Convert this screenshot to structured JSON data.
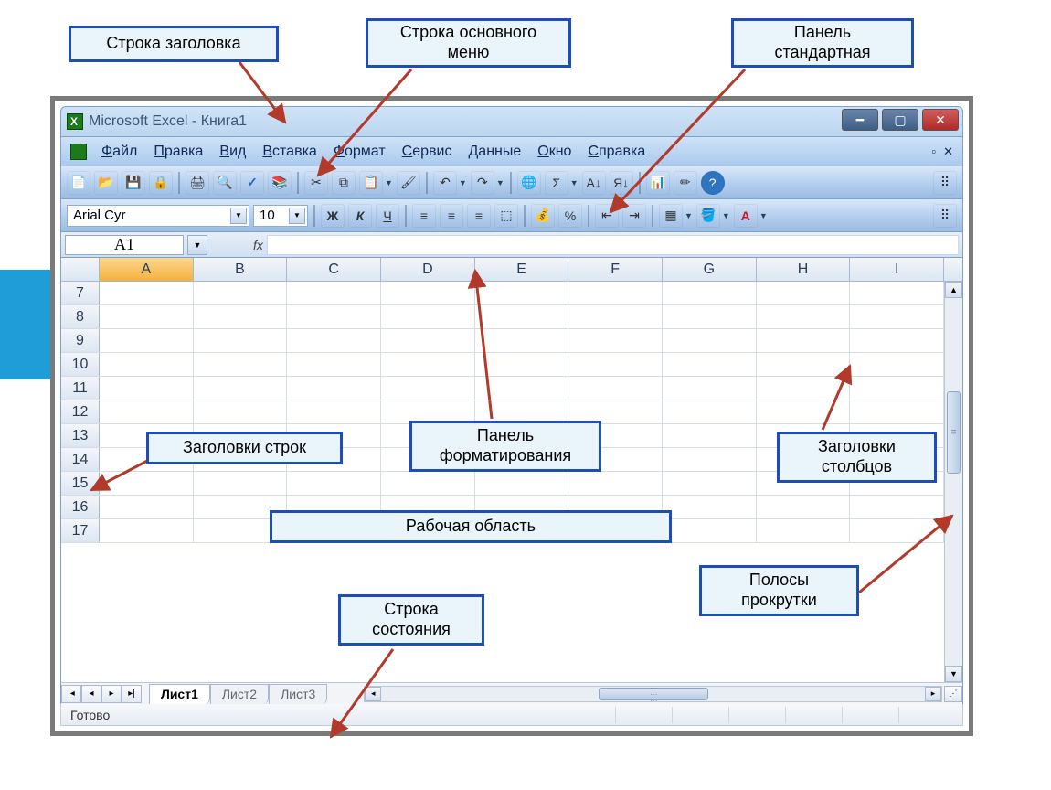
{
  "callouts": {
    "title_row": "Строка заголовка",
    "menu_row": "Строка основного\nменю",
    "standard_panel": "Панель\nстандартная",
    "row_headers": "Заголовки строк",
    "format_panel": "Панель\nформатирования",
    "col_headers": "Заголовки\nстолбцов",
    "workspace": "Рабочая область",
    "status_row": "Строка\nсостояния",
    "scrollbars": "Полосы\nпрокрутки"
  },
  "window": {
    "title": "Microsoft Excel - Книга1"
  },
  "menu": {
    "items": [
      "Файл",
      "Правка",
      "Вид",
      "Вставка",
      "Формат",
      "Сервис",
      "Данные",
      "Окно",
      "Справка"
    ]
  },
  "format_toolbar": {
    "font_name": "Arial Cyr",
    "font_size": "10",
    "bold": "Ж",
    "italic": "К",
    "underline": "Ч",
    "percent": "%",
    "sigma": "Σ"
  },
  "namebox": {
    "value": "A1"
  },
  "formula_bar": {
    "fx": "fx"
  },
  "columns": [
    "A",
    "B",
    "C",
    "D",
    "E",
    "F",
    "G",
    "H",
    "I"
  ],
  "selected_column": "A",
  "row_start": 7,
  "row_end": 17,
  "sheets": {
    "active": "Лист1",
    "others": [
      "Лист2",
      "Лист3"
    ]
  },
  "status": {
    "text": "Готово"
  }
}
